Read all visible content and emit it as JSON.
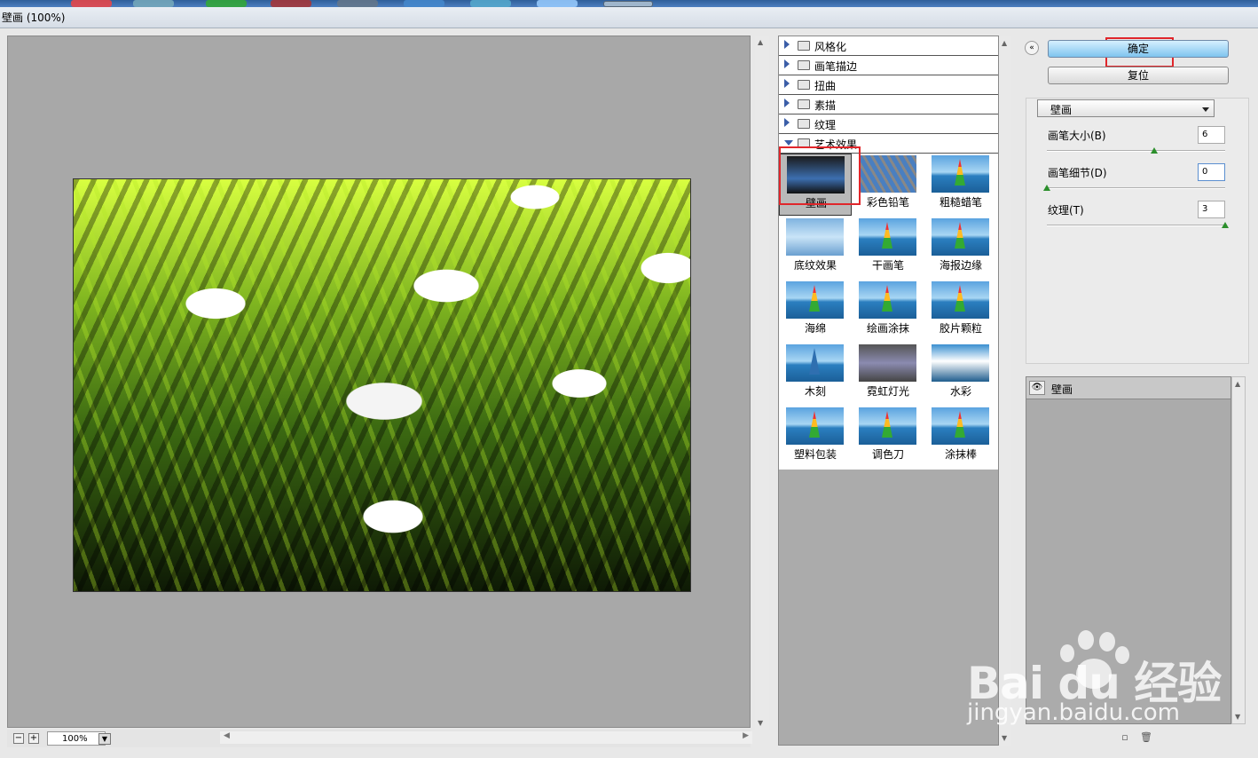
{
  "window": {
    "title": "壁画 (100%)"
  },
  "preview": {
    "zoom": "100%",
    "zoom_out": "−",
    "zoom_in": "+"
  },
  "categories": [
    {
      "label": "风格化",
      "expanded": false
    },
    {
      "label": "画笔描边",
      "expanded": false
    },
    {
      "label": "扭曲",
      "expanded": false
    },
    {
      "label": "素描",
      "expanded": false
    },
    {
      "label": "纹理",
      "expanded": false
    },
    {
      "label": "艺术效果",
      "expanded": true
    }
  ],
  "filters": [
    {
      "label": "壁画",
      "selected": true
    },
    {
      "label": "彩色铅笔"
    },
    {
      "label": "粗糙蜡笔"
    },
    {
      "label": "底纹效果"
    },
    {
      "label": "干画笔"
    },
    {
      "label": "海报边缘"
    },
    {
      "label": "海绵"
    },
    {
      "label": "绘画涂抹"
    },
    {
      "label": "胶片颗粒"
    },
    {
      "label": "木刻"
    },
    {
      "label": "霓虹灯光"
    },
    {
      "label": "水彩"
    },
    {
      "label": "塑料包装"
    },
    {
      "label": "调色刀"
    },
    {
      "label": "涂抹棒"
    }
  ],
  "buttons": {
    "ok": "确定",
    "reset": "复位",
    "collapse": "«"
  },
  "settings": {
    "filter_select": "壁画",
    "params": [
      {
        "label": "画笔大小(B)",
        "value": "6",
        "fraction": 0.6
      },
      {
        "label": "画笔细节(D)",
        "value": "0",
        "fraction": 0.0
      },
      {
        "label": "纹理(T)",
        "value": "3",
        "fraction": 1.0
      }
    ]
  },
  "layers": {
    "items": [
      {
        "label": "壁画",
        "eye": "👁"
      }
    ],
    "new_icon": "▫",
    "delete_icon": "🗑"
  },
  "watermark": {
    "brand": "Bai du 经验",
    "url": "jingyan.baidu.com"
  },
  "colors": {
    "highlight": "#e0262b",
    "ok_button": "#7fc4ef"
  }
}
